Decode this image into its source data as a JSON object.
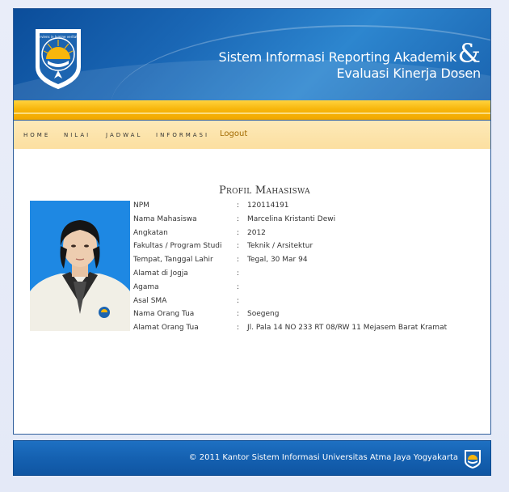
{
  "header": {
    "title_line1": "Sistem Informasi Reporting Akademik",
    "ampersand": "&",
    "title_line2": "Evaluasi Kinerja Dosen",
    "logo_icon": "university-seal-icon",
    "logo_text": "serviens in lumine veritatis"
  },
  "nav": {
    "items": [
      "HOME",
      "NILAI",
      "JADWAL",
      "INFORMASI"
    ],
    "logout": "Logout"
  },
  "profile": {
    "title": "Profil Mahasiswa",
    "fields": [
      {
        "label": "NPM",
        "value": "120114191"
      },
      {
        "label": "Nama Mahasiswa",
        "value": "Marcelina Kristanti Dewi"
      },
      {
        "label": "Angkatan",
        "value": "2012"
      },
      {
        "label": "Fakultas / Program Studi",
        "value": "Teknik / Arsitektur"
      },
      {
        "label": "Tempat, Tanggal Lahir",
        "value": "Tegal, 30 Mar 94"
      },
      {
        "label": "Alamat di Jogja",
        "value": ""
      },
      {
        "label": "Agama",
        "value": ""
      },
      {
        "label": "Asal SMA",
        "value": ""
      },
      {
        "label": "Nama Orang Tua",
        "value": "Soegeng"
      },
      {
        "label": "Alamat Orang Tua",
        "value": "Jl. Pala 14 NO 233 RT 08/RW 11 Mejasem Barat Kramat"
      }
    ],
    "colon": ":"
  },
  "footer": {
    "text": "© 2011 Kantor Sistem Informasi Universitas Atma Jaya Yogyakarta",
    "logo_icon": "university-seal-icon"
  },
  "colors": {
    "header_blue": "#1a67b5",
    "gold": "#f7b60c",
    "nav_bg": "#fde9b8",
    "footer_blue": "#1561b1"
  }
}
